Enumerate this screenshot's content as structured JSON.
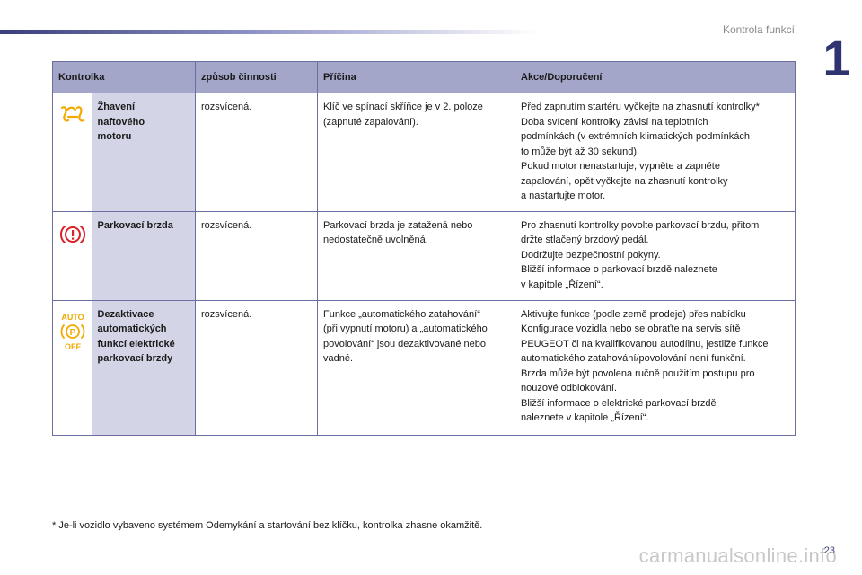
{
  "header": {
    "section_title": "Kontrola funkcí",
    "chapter_number": "1"
  },
  "table": {
    "columns": [
      "Kontrolka",
      "způsob činnosti",
      "Příčina",
      "Akce/Doporučení"
    ],
    "rows": [
      {
        "icon": "glow-plug-icon",
        "name_lines": [
          "Žhavení",
          "naftového",
          "motoru"
        ],
        "mode": "rozsvícená.",
        "cause_lines": [
          "Klíč ve spínací skříňce je v 2. poloze",
          "(zapnuté zapalování)."
        ],
        "action_lines": [
          "Před zapnutím startéru vyčkejte na zhasnutí kontrolky*.",
          "Doba svícení kontrolky závisí na teplotních",
          "podmínkách (v extrémních klimatických podmínkách",
          "to může být až 30 sekund).",
          "Pokud motor nenastartuje, vypněte a zapněte",
          "zapalování, opět vyčkejte na zhasnutí kontrolky",
          "a nastartujte motor."
        ]
      },
      {
        "icon": "parking-brake-icon",
        "name_lines": [
          "Parkovací brzda"
        ],
        "mode": "rozsvícená.",
        "cause_lines": [
          "Parkovací brzda je zatažená nebo",
          "nedostatečně uvolněná."
        ],
        "action_lines": [
          "Pro zhasnutí kontrolky povolte parkovací brzdu, přitom",
          "držte stlačený brzdový pedál.",
          "Dodržujte bezpečnostní pokyny.",
          "Bližší informace o parkovací brzdě naleznete",
          "v kapitole „Řízení“."
        ]
      },
      {
        "icon": "auto-p-off-icon",
        "icon_text": {
          "top": "AUTO",
          "mid": "P",
          "bottom": "OFF"
        },
        "name_lines": [
          "Dezaktivace",
          "automatických",
          "funkcí elektrické",
          "parkovací brzdy"
        ],
        "mode": "rozsvícená.",
        "cause_lines": [
          "Funkce „automatického zatahování“",
          "(při vypnutí motoru) a „automatického",
          "povolování“ jsou dezaktivované nebo",
          "vadné."
        ],
        "action_lines": [
          "Aktivujte funkce (podle země prodeje) přes nabídku",
          "Konfigurace vozidla nebo se obraťte na servis sítě",
          "PEUGEOT či na kvalifikovanou autodílnu, jestliže funkce",
          "automatického zatahování/povolování není funkční.",
          "Brzda může být povolena ručně použitím postupu pro",
          "nouzové odblokování.",
          "Bližší informace o elektrické parkovací brzdě",
          "naleznete v kapitole „Řízení“."
        ]
      }
    ]
  },
  "footnote": "* Je-li vozidlo vybaveno systémem Odemykání a startování bez klíčku, kontrolka zhasne okamžitě.",
  "page_number": "23",
  "watermark": "carmanualsonline.info",
  "colors": {
    "header_bg": "#a3a6c9",
    "name_cell_bg": "#d3d4e6",
    "border": "#6a6fa0",
    "icon_amber": "#f2a900",
    "icon_red": "#d8232a",
    "chapter": "#2f3370"
  }
}
